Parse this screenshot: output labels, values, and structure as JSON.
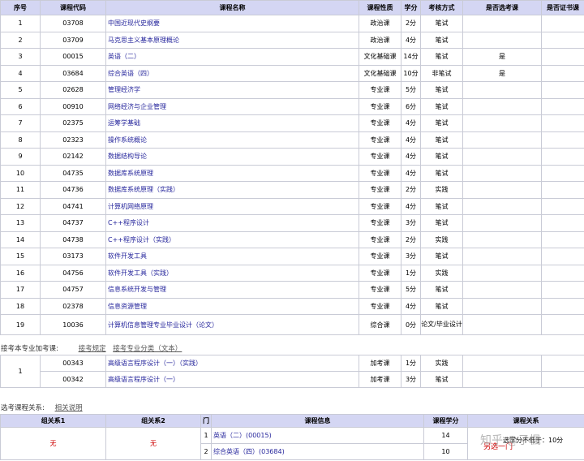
{
  "main_table": {
    "headers": [
      "序号",
      "课程代码",
      "课程名称",
      "课程性质",
      "学分",
      "考核方式",
      "是否选考课",
      "是否证书课"
    ],
    "rows": [
      {
        "no": "1",
        "code": "03708",
        "name": "中国近现代史纲要",
        "type": "政治课",
        "credit": "2分",
        "exam": "笔试",
        "optional": "",
        "cert": ""
      },
      {
        "no": "2",
        "code": "03709",
        "name": "马克思主义基本原理概论",
        "type": "政治课",
        "credit": "4分",
        "exam": "笔试",
        "optional": "",
        "cert": ""
      },
      {
        "no": "3",
        "code": "00015",
        "name": "英语（二）",
        "type": "文化基础课",
        "credit": "14分",
        "exam": "笔试",
        "optional": "是",
        "cert": ""
      },
      {
        "no": "4",
        "code": "03684",
        "name": "综合英语（四）",
        "type": "文化基础课",
        "credit": "10分",
        "exam": "非笔试",
        "optional": "是",
        "cert": ""
      },
      {
        "no": "5",
        "code": "02628",
        "name": "管理经济学",
        "type": "专业课",
        "credit": "5分",
        "exam": "笔试",
        "optional": "",
        "cert": ""
      },
      {
        "no": "6",
        "code": "00910",
        "name": "网络经济与企业管理",
        "type": "专业课",
        "credit": "6分",
        "exam": "笔试",
        "optional": "",
        "cert": ""
      },
      {
        "no": "7",
        "code": "02375",
        "name": "运筹学基础",
        "type": "专业课",
        "credit": "4分",
        "exam": "笔试",
        "optional": "",
        "cert": ""
      },
      {
        "no": "8",
        "code": "02323",
        "name": "操作系统概论",
        "type": "专业课",
        "credit": "4分",
        "exam": "笔试",
        "optional": "",
        "cert": ""
      },
      {
        "no": "9",
        "code": "02142",
        "name": "数据结构导论",
        "type": "专业课",
        "credit": "4分",
        "exam": "笔试",
        "optional": "",
        "cert": ""
      },
      {
        "no": "10",
        "code": "04735",
        "name": "数据库系统原理",
        "type": "专业课",
        "credit": "4分",
        "exam": "笔试",
        "optional": "",
        "cert": ""
      },
      {
        "no": "11",
        "code": "04736",
        "name": "数据库系统原理（实践）",
        "type": "专业课",
        "credit": "2分",
        "exam": "实践",
        "optional": "",
        "cert": ""
      },
      {
        "no": "12",
        "code": "04741",
        "name": "计算机网络原理",
        "type": "专业课",
        "credit": "4分",
        "exam": "笔试",
        "optional": "",
        "cert": ""
      },
      {
        "no": "13",
        "code": "04737",
        "name": "C++程序设计",
        "type": "专业课",
        "credit": "3分",
        "exam": "笔试",
        "optional": "",
        "cert": ""
      },
      {
        "no": "14",
        "code": "04738",
        "name": "C++程序设计（实践）",
        "type": "专业课",
        "credit": "2分",
        "exam": "实践",
        "optional": "",
        "cert": ""
      },
      {
        "no": "15",
        "code": "03173",
        "name": "软件开发工具",
        "type": "专业课",
        "credit": "3分",
        "exam": "笔试",
        "optional": "",
        "cert": ""
      },
      {
        "no": "16",
        "code": "04756",
        "name": "软件开发工具（实践）",
        "type": "专业课",
        "credit": "1分",
        "exam": "实践",
        "optional": "",
        "cert": ""
      },
      {
        "no": "17",
        "code": "04757",
        "name": "信息系统开发与管理",
        "type": "专业课",
        "credit": "5分",
        "exam": "笔试",
        "optional": "",
        "cert": ""
      },
      {
        "no": "18",
        "code": "02378",
        "name": "信息资源管理",
        "type": "专业课",
        "credit": "4分",
        "exam": "笔试",
        "optional": "",
        "cert": ""
      },
      {
        "no": "19",
        "code": "10036",
        "name": "计算机信息管理专业毕业设计（论文）",
        "type": "综合课",
        "credit": "0分",
        "exam": "论文/毕业设计",
        "optional": "",
        "cert": ""
      }
    ]
  },
  "extra_section": {
    "title": "接考本专业加考课:",
    "link1": "接考规定",
    "link2": "接考专业分类（文本）",
    "group_no": "1",
    "rows": [
      {
        "code": "00343",
        "name": "高级语言程序设计（一）（实践）",
        "type": "加考课",
        "credit": "1分",
        "exam": "实践"
      },
      {
        "code": "00342",
        "name": "高级语言程序设计（一）",
        "type": "加考课",
        "credit": "3分",
        "exam": "笔试"
      }
    ]
  },
  "relation_section": {
    "title": "选考课程关系:",
    "link": "相关说明",
    "headers": [
      "组关系1",
      "组关系2",
      "门",
      "课程信息",
      "课程学分",
      "课程关系"
    ],
    "group1": "无",
    "group2": "无",
    "rows": [
      {
        "idx": "1",
        "info": "英语（二）(00015)",
        "credit": "14"
      },
      {
        "idx": "2",
        "info": "综合英语（四）(03684)",
        "credit": "10"
      }
    ],
    "relation_red": "另选一门",
    "relation_note": "选学分不低于：10分"
  },
  "watermark": "知乎 @子楓",
  "colors": {
    "header_bg": "#d4d6f3",
    "link": "#26269c",
    "red": "#cc0000",
    "border": "#c9cbd6"
  }
}
